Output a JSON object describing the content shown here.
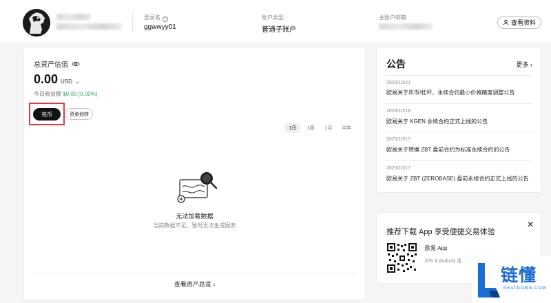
{
  "header": {
    "login_label": "登录名",
    "login_value": "ggwwyy01",
    "account_type_label": "账户类型",
    "account_type_value": "普通子账户",
    "main_email_label": "主账户邮箱",
    "profile_button": "查看资料"
  },
  "assets": {
    "title": "总资产估值",
    "amount": "0.00",
    "currency": "USD",
    "pnl_label": "今日收益额",
    "pnl_value": "$0.00 (0.00%)",
    "deposit_button": "充币",
    "transfer_button": "资金划转",
    "ranges": [
      "1日",
      "1周",
      "1月",
      "半年"
    ],
    "empty_title": "无法加载数据",
    "empty_subtitle": "当前数据不足，暂时无法生成图表",
    "overview_link": "查看资产总览 ›"
  },
  "announcements": {
    "title": "公告",
    "more": "更多 ›",
    "items": [
      {
        "date": "2025/10/21",
        "text": "欧易关于币币/杠杆、永续合约最小价格精度调整公告"
      },
      {
        "date": "2025/10/18",
        "text": "欧易关于 KGEN 永续合约正式上线的公告"
      },
      {
        "date": "2025/10/17",
        "text": "欧易关于转换 ZBT 盘前合约为标准永续合约的公告"
      },
      {
        "date": "2025/10/17",
        "text": "欧易关于 ZBT (ZEROBASE) 盘前永续合约正式上线的公告"
      }
    ]
  },
  "download": {
    "title": "推荐下载 App 享受便捷交易体验",
    "close": "✕",
    "app_name": "欧易 App",
    "platforms": "iOS & Android 请"
  },
  "watermark": {
    "text": "链懂",
    "sub": "NEATDOWN.COM"
  }
}
